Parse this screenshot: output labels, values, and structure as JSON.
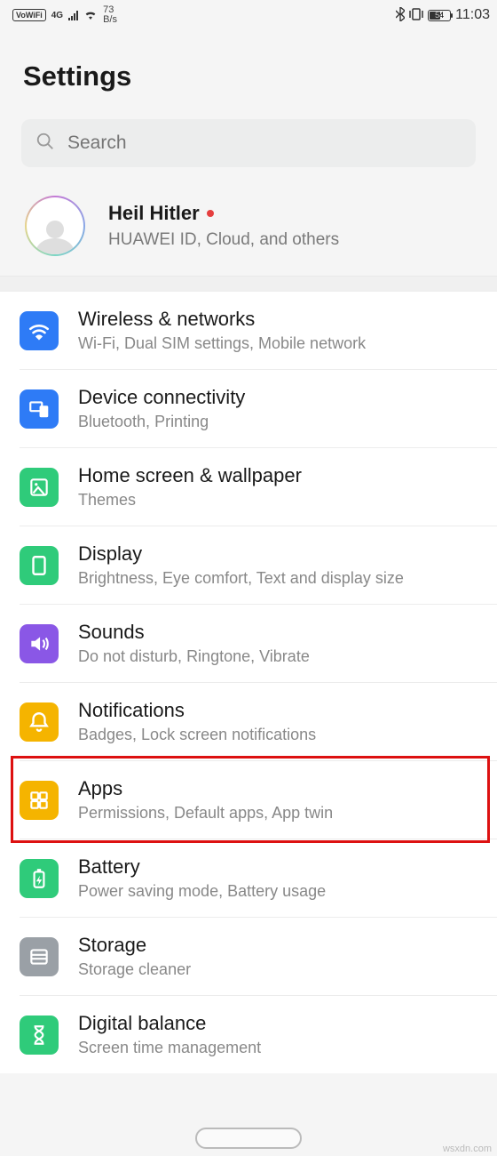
{
  "statusbar": {
    "vowifi": "VoWiFi",
    "net_gen": "4G",
    "speed_num": "73",
    "speed_unit": "B/s",
    "battery_pct": "54",
    "time": "11:03"
  },
  "header": {
    "title": "Settings"
  },
  "search": {
    "placeholder": "Search"
  },
  "user": {
    "name": "Heil Hitler",
    "sub": "HUAWEI ID, Cloud, and others"
  },
  "items": [
    {
      "icon": "wifi",
      "color": "#2e7bf6",
      "title": "Wireless & networks",
      "sub": "Wi-Fi, Dual SIM settings, Mobile network"
    },
    {
      "icon": "devices",
      "color": "#2e7bf6",
      "title": "Device connectivity",
      "sub": "Bluetooth, Printing"
    },
    {
      "icon": "home",
      "color": "#2fcb7a",
      "title": "Home screen & wallpaper",
      "sub": "Themes"
    },
    {
      "icon": "display",
      "color": "#2fcb7a",
      "title": "Display",
      "sub": "Brightness, Eye comfort, Text and display size"
    },
    {
      "icon": "sound",
      "color": "#8a57e6",
      "title": "Sounds",
      "sub": "Do not disturb, Ringtone, Vibrate"
    },
    {
      "icon": "bell",
      "color": "#f5b400",
      "title": "Notifications",
      "sub": "Badges, Lock screen notifications"
    },
    {
      "icon": "apps",
      "color": "#f5b400",
      "title": "Apps",
      "sub": "Permissions, Default apps, App twin"
    },
    {
      "icon": "battery",
      "color": "#2fcb7a",
      "title": "Battery",
      "sub": "Power saving mode, Battery usage"
    },
    {
      "icon": "storage",
      "color": "#9aa0a6",
      "title": "Storage",
      "sub": "Storage cleaner"
    },
    {
      "icon": "hourglass",
      "color": "#2fcb7a",
      "title": "Digital balance",
      "sub": "Screen time management"
    }
  ],
  "highlight_index": 6,
  "watermark": "wsxdn.com"
}
